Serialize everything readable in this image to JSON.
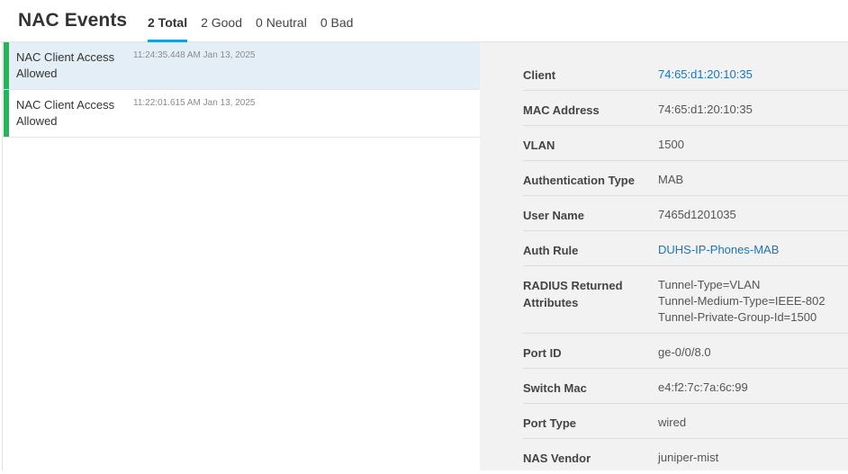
{
  "header": {
    "title": "NAC Events",
    "tabs": [
      {
        "label": "2 Total",
        "active": true
      },
      {
        "label": "2 Good",
        "active": false
      },
      {
        "label": "0 Neutral",
        "active": false
      },
      {
        "label": "0 Bad",
        "active": false
      }
    ]
  },
  "events": [
    {
      "title": "NAC Client Access Allowed",
      "time": "11:24:35.448 AM Jan 13, 2025",
      "status": "good",
      "selected": true
    },
    {
      "title": "NAC Client Access Allowed",
      "time": "11:22:01.615 AM Jan 13, 2025",
      "status": "good",
      "selected": false
    }
  ],
  "colors": {
    "accent": "#1a9fd9",
    "good": "#27b35a",
    "link": "#1a75c2",
    "selected_row": "#e4eef7"
  },
  "details": [
    {
      "label": "Client",
      "value": "74:65:d1:20:10:35",
      "link": true
    },
    {
      "label": "MAC Address",
      "value": "74:65:d1:20:10:35",
      "link": false
    },
    {
      "label": "VLAN",
      "value": "1500",
      "link": false
    },
    {
      "label": "Authentication Type",
      "value": "MAB",
      "link": false
    },
    {
      "label": "User Name",
      "value": "7465d1201035",
      "link": false
    },
    {
      "label": "Auth Rule",
      "value": "DUHS-IP-Phones-MAB",
      "link": true
    },
    {
      "label": "RADIUS Returned Attributes",
      "value": "Tunnel-Type=VLAN\nTunnel-Medium-Type=IEEE-802\nTunnel-Private-Group-Id=1500",
      "link": false
    },
    {
      "label": "Port ID",
      "value": "ge-0/0/8.0",
      "link": false
    },
    {
      "label": "Switch Mac",
      "value": "e4:f2:7c:7a:6c:99",
      "link": false
    },
    {
      "label": "Port Type",
      "value": "wired",
      "link": false
    },
    {
      "label": "NAS Vendor",
      "value": "juniper-mist",
      "link": false
    }
  ]
}
